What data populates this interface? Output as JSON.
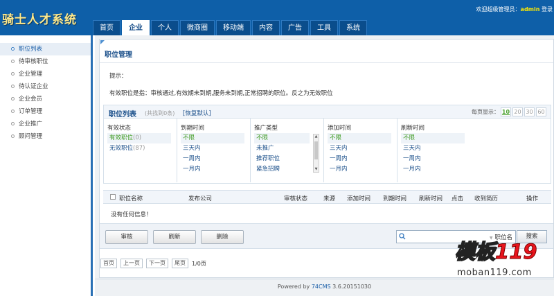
{
  "app": {
    "logo_text": "骑士人才系统"
  },
  "header": {
    "greeting": "欢迎超级管理员：",
    "username": "admin",
    "login_link": "登录"
  },
  "nav": {
    "tabs": [
      {
        "label": "首页"
      },
      {
        "label": "企业"
      },
      {
        "label": "个人"
      },
      {
        "label": "微商圈"
      },
      {
        "label": "移动端"
      },
      {
        "label": "内容"
      },
      {
        "label": "广告"
      },
      {
        "label": "工具"
      },
      {
        "label": "系统"
      }
    ],
    "active": "企业"
  },
  "sidebar": {
    "items": [
      {
        "label": "职位列表"
      },
      {
        "label": "待审核职位"
      },
      {
        "label": "企业管理"
      },
      {
        "label": "待认证企业"
      },
      {
        "label": "企业会员"
      },
      {
        "label": "订单管理"
      },
      {
        "label": "企业推广"
      },
      {
        "label": "顾问管理"
      }
    ],
    "active": "职位列表"
  },
  "main": {
    "title": "职位管理",
    "tip_label": "提示：",
    "tip_text": "有效职位是指：审核通过,有效期未到期,服务未到期,正常招聘的职位。反之为无效职位",
    "list_title": "职位列表",
    "list_count": "(共找到0条)",
    "reset_link": "[恢复默认]",
    "page_size_label": "每页显示：",
    "page_sizes": [
      "10",
      "20",
      "30",
      "60"
    ],
    "page_size_selected": "10"
  },
  "filters": [
    {
      "title": "有效状态",
      "options": [
        "有效职位",
        "无效职位"
      ],
      "counts": [
        "(0)",
        "(87)"
      ]
    },
    {
      "title": "到期时间",
      "options": [
        "不限",
        "三天内",
        "一周内",
        "一月内"
      ]
    },
    {
      "title": "推广类型",
      "options": [
        "不限",
        "未推广",
        "推荐职位",
        "紧急招聘"
      ]
    },
    {
      "title": "添加时间",
      "options": [
        "不限",
        "三天内",
        "一周内",
        "一月内"
      ]
    },
    {
      "title": "刷新时间",
      "options": [
        "不限",
        "三天内",
        "一周内",
        "一月内"
      ]
    }
  ],
  "table": {
    "columns": [
      "职位名称",
      "发布公司",
      "审核状态",
      "来源",
      "添加时间",
      "到期时间",
      "刷新时间",
      "点击",
      "收到简历",
      "操作"
    ],
    "empty_message": "没有任何信息！"
  },
  "actions": {
    "audit": "审核",
    "refresh": "刷新",
    "delete": "删除"
  },
  "search": {
    "placeholder": "",
    "type_label": "职位名",
    "button": "搜索"
  },
  "pager": {
    "first": "首页",
    "prev": "上一页",
    "next": "下一页",
    "last": "尾页",
    "info": "1/0页"
  },
  "footer": {
    "prefix": "Powered by ",
    "brand": "74CMS",
    "version": " 3.6.20151030"
  },
  "watermark": {
    "main_text": "模板",
    "number": "119",
    "sub_text": "moban119.com"
  },
  "colors": {
    "header_bg": "#0e5fa8",
    "accent": "#1a4f8a",
    "active_green": "#3c9a1e"
  }
}
